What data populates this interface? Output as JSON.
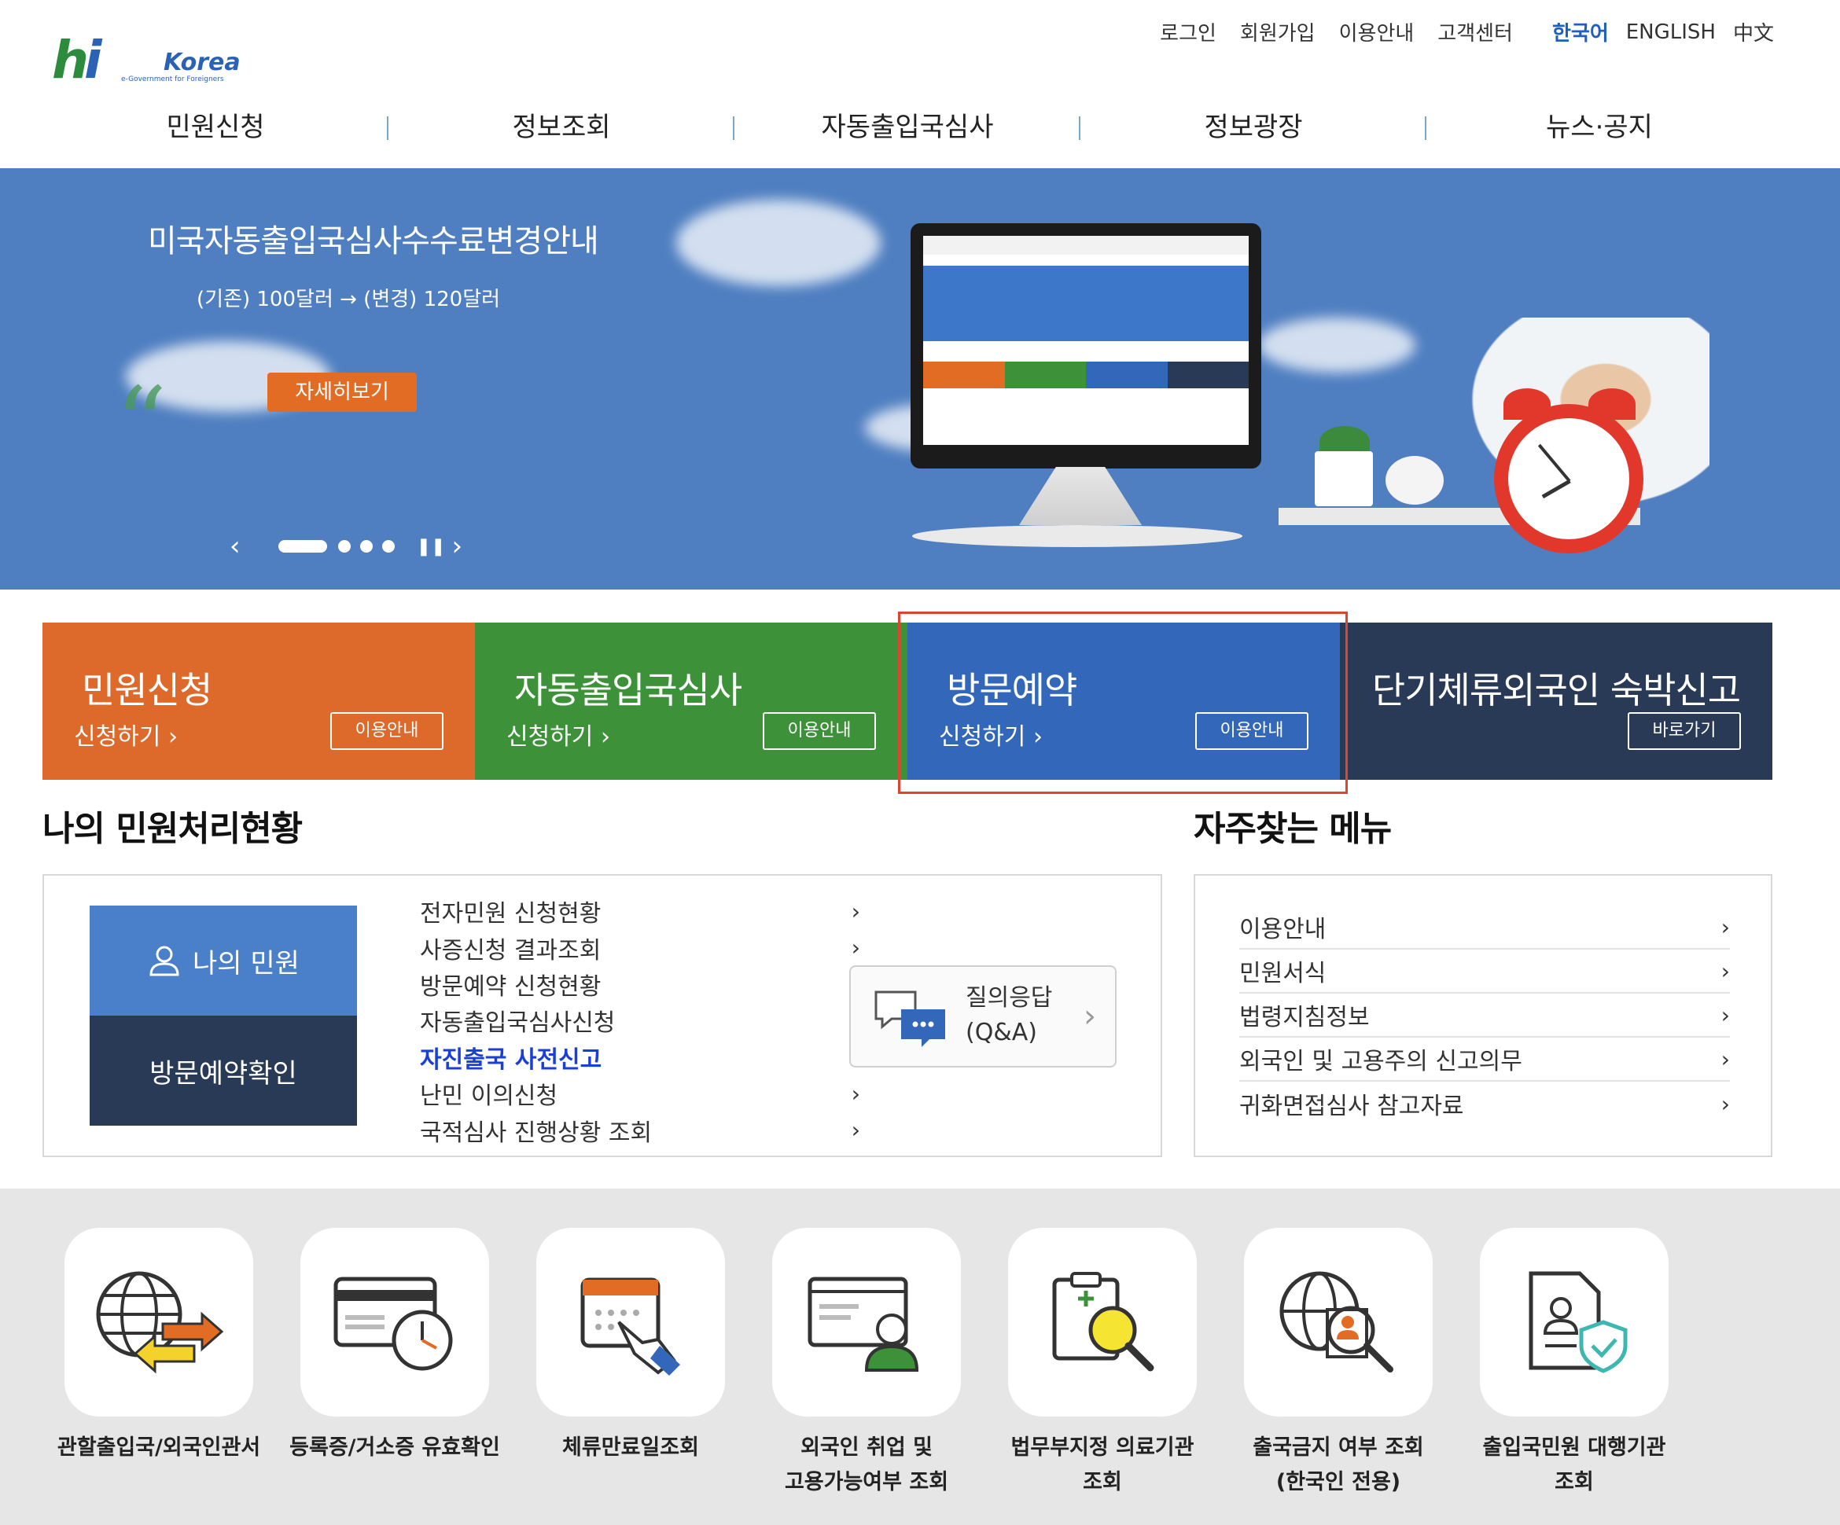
{
  "logo": {
    "hi": "Hi",
    "korea": "Korea",
    "tagline": "e-Government for Foreigners"
  },
  "util_links": [
    "로그인",
    "회원가입",
    "이용안내",
    "고객센터"
  ],
  "languages": {
    "korean": "한국어",
    "english": "ENGLISH",
    "chinese": "中文"
  },
  "gnb": [
    "민원신청",
    "정보조회",
    "자동출입국심사",
    "정보광장",
    "뉴스·공지"
  ],
  "banner": {
    "title": "미국자동출입국심사수수료변경안내",
    "subtitle": "(기존) 100달러 → (변경) 120달러",
    "button": "자세히보기",
    "prev": "‹",
    "next": "›",
    "pause": "❚❚"
  },
  "tiles": [
    {
      "title": "민원신청",
      "apply": "신청하기",
      "guide": "이용안내",
      "color": "#dd6a2b"
    },
    {
      "title": "자동출입국심사",
      "apply": "신청하기",
      "guide": "이용안내",
      "color": "#3d9239"
    },
    {
      "title": "방문예약",
      "apply": "신청하기",
      "guide": "이용안내",
      "color": "#3367b9"
    },
    {
      "title": "단기체류외국인 숙박신고",
      "apply": "",
      "guide": "바로가기",
      "color": "#293a57"
    }
  ],
  "status": {
    "title": "나의 민원처리현황",
    "my_button": "나의 민원",
    "visit_button": "방문예약확인",
    "items": [
      "전자민원 신청현황",
      "사증신청 결과조회",
      "방문예약 신청현황",
      "자동출입국심사신청",
      "자진출국 사전신고",
      "난민 이의신청",
      "국적심사 진행상황 조회"
    ],
    "qa_line1": "질의응답",
    "qa_line2": "(Q&A)"
  },
  "favorites": {
    "title": "자주찾는 메뉴",
    "items": [
      "이용안내",
      "민원서식",
      "법령지침정보",
      "외국인 및 고용주의 신고의무",
      "귀화면접심사 참고자료"
    ]
  },
  "quick_menu": [
    {
      "line1": "관할출입국/외국인관서",
      "line2": ""
    },
    {
      "line1": "등록증/거소증 유효확인",
      "line2": ""
    },
    {
      "line1": "체류만료일조회",
      "line2": ""
    },
    {
      "line1": "외국인 취업 및",
      "line2": "고용가능여부 조회"
    },
    {
      "line1": "법무부지정 의료기관",
      "line2": "조회"
    },
    {
      "line1": "출국금지 여부 조회",
      "line2": "(한국인 전용)"
    },
    {
      "line1": "출입국민원 대행기관",
      "line2": "조회"
    }
  ]
}
